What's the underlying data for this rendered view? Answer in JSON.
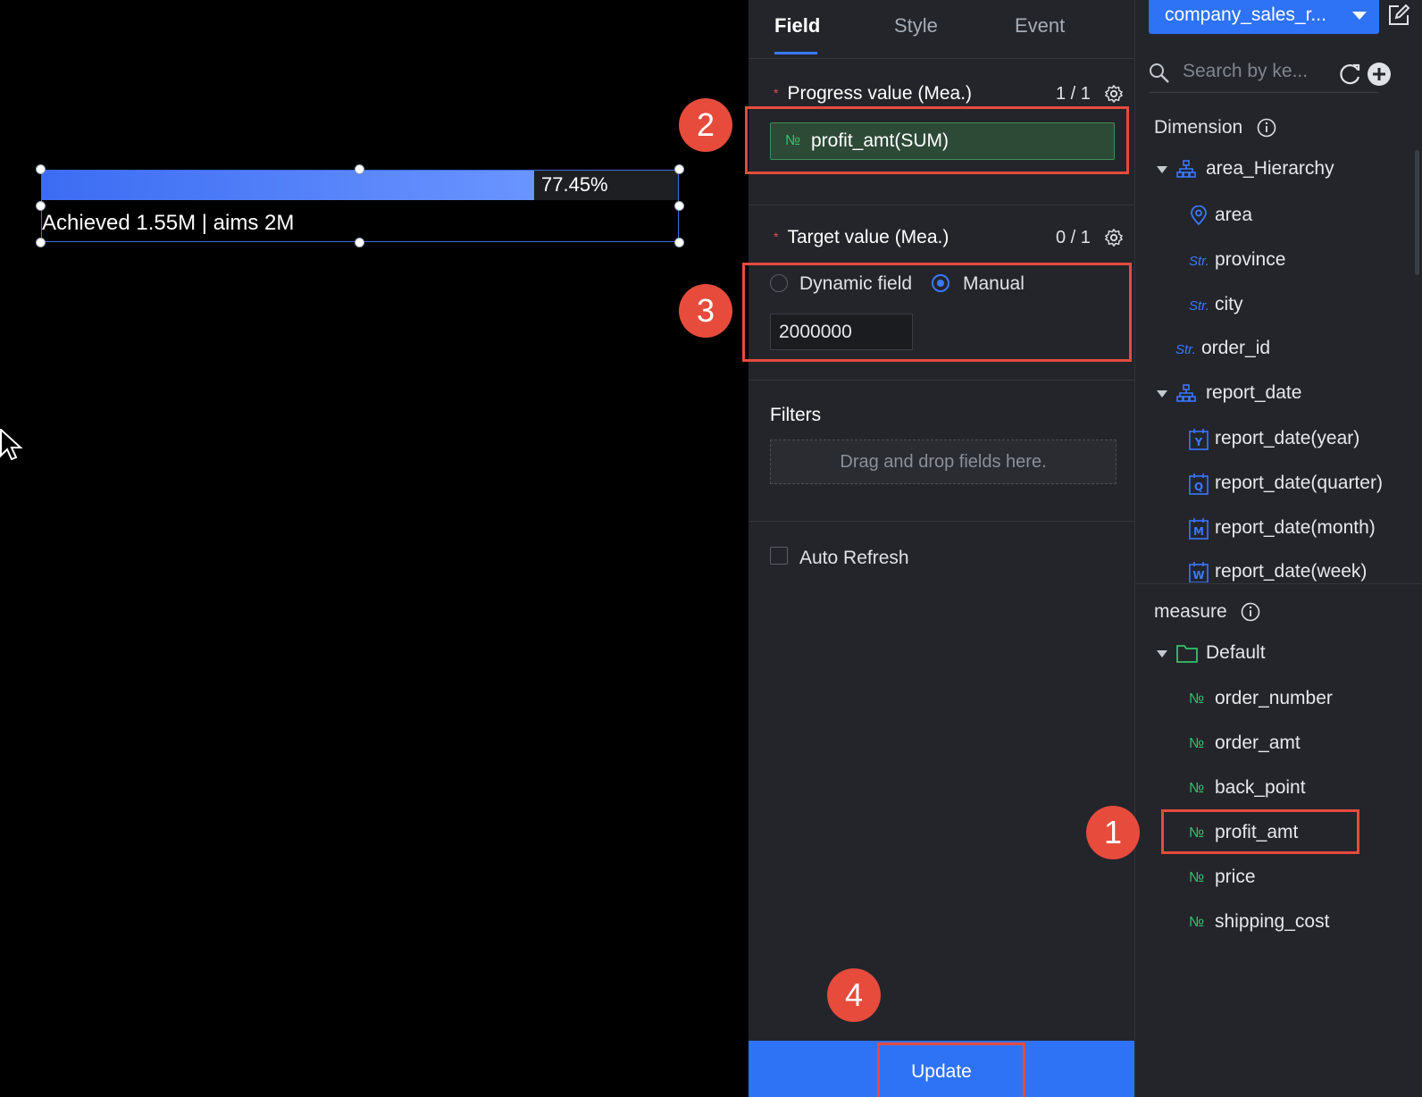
{
  "canvas": {
    "progress": {
      "percent_label": "77.45%",
      "fill_fraction": 0.7745,
      "caption": "Achieved 1.55M | aims 2M"
    }
  },
  "config": {
    "tabs": [
      {
        "label": "Field",
        "active": true
      },
      {
        "label": "Style",
        "active": false
      },
      {
        "label": "Event",
        "active": false
      }
    ],
    "progress_value": {
      "required_mark": "*",
      "title": "Progress value (Mea.)",
      "count": "1 / 1",
      "field_icon": "№",
      "field_label": "profit_amt(SUM)"
    },
    "target_value": {
      "required_mark": "*",
      "title": "Target value (Mea.)",
      "count": "0 / 1",
      "options": [
        {
          "label": "Dynamic field",
          "selected": false
        },
        {
          "label": "Manual",
          "selected": true
        }
      ],
      "manual_value": "2000000"
    },
    "filters": {
      "title": "Filters",
      "placeholder": "Drag and drop fields here."
    },
    "auto_refresh": {
      "label": "Auto Refresh",
      "checked": false
    },
    "update_button": "Update"
  },
  "fields": {
    "dataset": "company_sales_r...",
    "search_placeholder": "Search by ke...",
    "dimension_title": "Dimension",
    "dimension_items": [
      {
        "label": "area_Hierarchy",
        "type": "hierarchy"
      },
      {
        "label": "area",
        "type": "geo"
      },
      {
        "label": "province",
        "type": "str"
      },
      {
        "label": "city",
        "type": "str"
      },
      {
        "label": "order_id",
        "type": "str"
      },
      {
        "label": "report_date",
        "type": "hierarchy"
      },
      {
        "label": "report_date(year)",
        "type": "date",
        "letter": "Y"
      },
      {
        "label": "report_date(quarter)",
        "type": "date",
        "letter": "Q"
      },
      {
        "label": "report_date(month)",
        "type": "date",
        "letter": "M"
      },
      {
        "label": "report_date(week)",
        "type": "date",
        "letter": "W"
      }
    ],
    "str_icon": "Str.",
    "num_icon": "№",
    "measure_title": "measure",
    "measure_folder": "Default",
    "measure_items": [
      {
        "label": "order_number"
      },
      {
        "label": "order_amt"
      },
      {
        "label": "back_point"
      },
      {
        "label": "profit_amt"
      },
      {
        "label": "price"
      },
      {
        "label": "shipping_cost"
      }
    ]
  },
  "annotations": {
    "badges": [
      "1",
      "2",
      "3",
      "4"
    ],
    "color": "#e64b3c"
  },
  "colors": {
    "accent": "#2e73f5",
    "measure_green": "#35c26b",
    "progress_fill": "#5b86ff"
  }
}
